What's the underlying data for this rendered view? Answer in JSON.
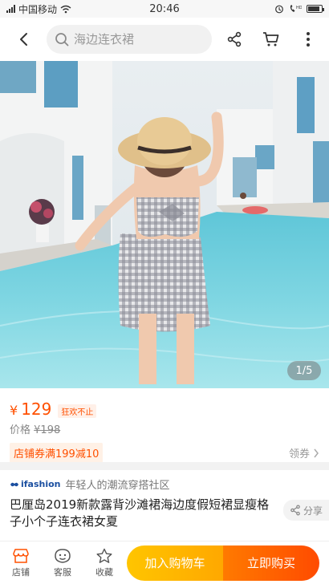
{
  "status_bar": {
    "carrier": "中国移动",
    "time": "20:46",
    "battery_level": 0.85
  },
  "header": {
    "search_placeholder": "海边连衣裙",
    "icons": [
      "back-icon",
      "search-icon",
      "share-icon",
      "cart-icon",
      "more-icon"
    ]
  },
  "gallery": {
    "current": "1",
    "separator": "/",
    "total": "5",
    "indicator": "1/5"
  },
  "price": {
    "currency": "¥",
    "value": "129",
    "tag": "狂欢不止",
    "original_label": "价格",
    "original_value": "¥198"
  },
  "coupon": {
    "label": "店铺券满199减10",
    "link": "领券"
  },
  "brand": {
    "logo_text": "ifashion",
    "slogan": "年轻人的潮流穿搭社区"
  },
  "product": {
    "title": "巴厘岛2019新款露背沙滩裙海边度假短裙显瘦格子小个子连衣裙女夏",
    "share_label": "分享"
  },
  "bottom_bar": {
    "tabs": [
      {
        "label": "店铺",
        "icon": "shop-icon"
      },
      {
        "label": "客服",
        "icon": "customer-service-icon"
      },
      {
        "label": "收藏",
        "icon": "star-icon"
      }
    ],
    "add_to_cart": "加入购物车",
    "buy_now": "立即购买"
  },
  "colors": {
    "accent": "#ff5000",
    "cart_button": "#ffb400",
    "buy_button": "#ff5a00"
  }
}
